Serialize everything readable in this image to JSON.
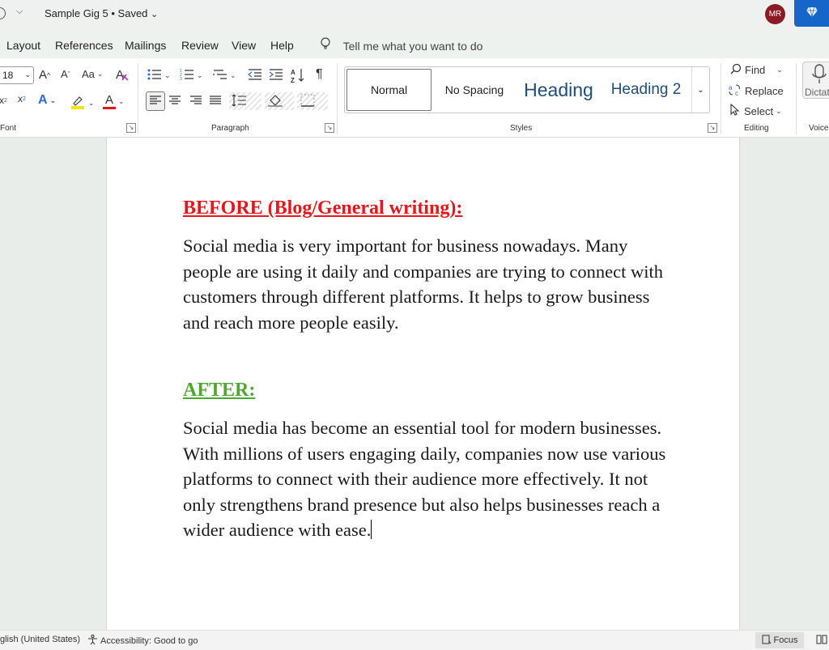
{
  "titlebar": {
    "doc_title": "Sample Gig 5 • Saved",
    "title_caret": "⌄",
    "avatar_initials": "MR",
    "premium_icon": "diamond-icon"
  },
  "menu": {
    "tabs": [
      "Layout",
      "References",
      "Mailings",
      "Review",
      "View",
      "Help"
    ],
    "tell_me": "Tell me what you want to do"
  },
  "ribbon": {
    "font": {
      "size": "18",
      "grow": "A",
      "shrink": "A",
      "change_case": "Aa",
      "subscript": "x",
      "subscript_mark": "2",
      "superscript": "x",
      "superscript_mark": "2",
      "text_effects": "A",
      "font_color": "A",
      "label": "Font"
    },
    "paragraph": {
      "label": "Paragraph",
      "sort": "A↓Z",
      "pilcrow": "¶"
    },
    "styles": {
      "items": [
        "Normal",
        "No Spacing",
        "Heading",
        "Heading 2"
      ],
      "label": "Styles"
    },
    "editing": {
      "find": "Find",
      "replace": "Replace",
      "select": "Select",
      "label": "Editing"
    },
    "voice": {
      "dictate": "Dictat",
      "label": "Voice"
    }
  },
  "document": {
    "before_heading": "BEFORE (Blog/General writing):",
    "before_text": "Social media is very important for business nowadays. Many people are using it daily and companies are trying to connect with customers through different platforms. It helps to grow business and reach more people easily.",
    "after_heading": "AFTER:",
    "after_text": "Social media has become an essential tool for modern businesses. With millions of users engaging daily, companies now use various platforms to connect with their audience more effectively. It not only strengthens brand presence but also helps businesses reach a wider audience with ease."
  },
  "colors": {
    "before_heading": "#e8161a",
    "after_heading": "#4ea72e",
    "heading_style": "#1e4e79",
    "premium": "#1566c8",
    "avatar": "#8b1a24"
  },
  "statusbar": {
    "language": "glish (United States)",
    "accessibility": "Accessibility: Good to go",
    "focus": "Focus"
  }
}
